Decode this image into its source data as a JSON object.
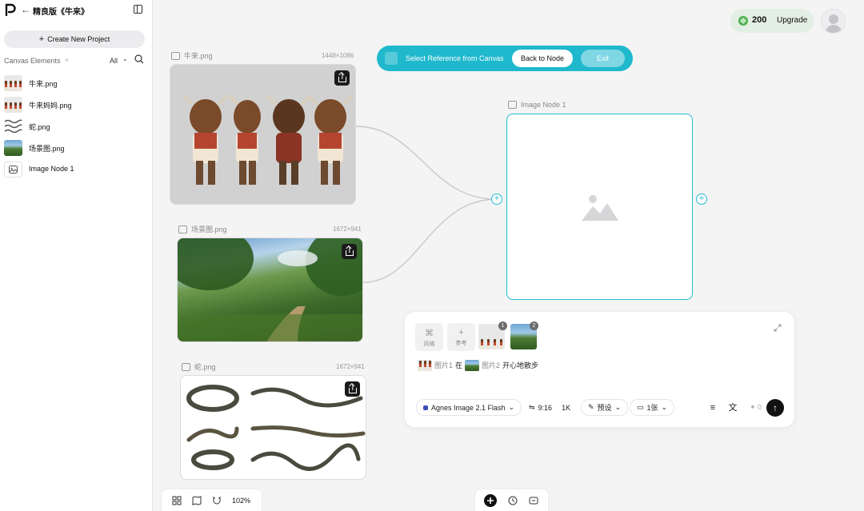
{
  "header": {
    "project_title": "精良版《牛来》"
  },
  "sidebar": {
    "create_label": "Create New Project",
    "elements_label": "Canvas Elements",
    "elements_clear": "×",
    "filter_value": "All",
    "items": [
      {
        "name": "牛来.png",
        "thumb": "bull"
      },
      {
        "name": "牛来妈妈.png",
        "thumb": "bull"
      },
      {
        "name": "蛇.png",
        "thumb": "snake"
      },
      {
        "name": "场景图.png",
        "thumb": "scene"
      },
      {
        "name": "Image Node 1",
        "thumb": "node"
      }
    ]
  },
  "canvas": {
    "nodes": {
      "bull": {
        "label": "牛来.png",
        "dims": "1448×1086"
      },
      "scene": {
        "label": "场景图.png",
        "dims": "1672×941"
      },
      "snake": {
        "label": "蛇.png",
        "dims": "1672×941"
      },
      "target": {
        "label": "Image Node 1"
      }
    },
    "ref_bar": {
      "text": "Select Reference from Canvas",
      "back_label": "Back to Node",
      "exit_label": "Exit"
    }
  },
  "account": {
    "credits": "200",
    "upgrade_label": "Upgrade"
  },
  "composer": {
    "style_label": "风格",
    "ref_label": "参考",
    "ref_badges": [
      "1",
      "2"
    ],
    "prompt": {
      "ref1": "图片1",
      "word_at": "在",
      "ref2": "图片2",
      "rest": "开心地散步"
    },
    "model": "Agnes Image 2.1 Flash",
    "ratio": "9:16",
    "resolution": "1K",
    "preset": "预设",
    "count": "1张",
    "cost": "0"
  },
  "bottom": {
    "zoom": "102%"
  },
  "colors": {
    "accent": "#1fb8cd",
    "credit_green": "#4caf50"
  }
}
